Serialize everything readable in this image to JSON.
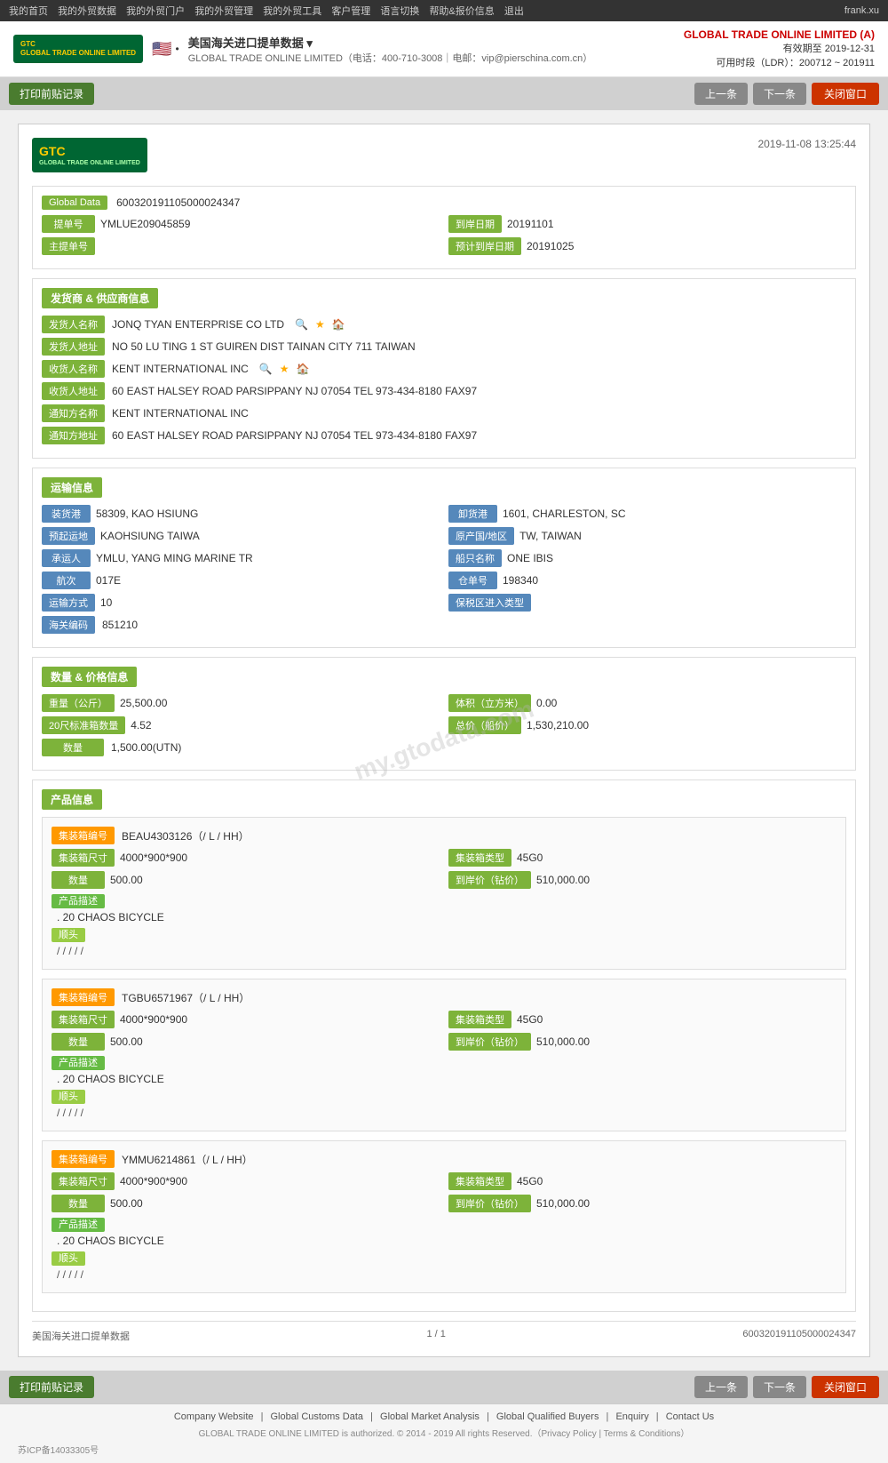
{
  "nav": {
    "items": [
      "我的首页",
      "我的外贸数据",
      "我的外贸门户",
      "我的外贸管理",
      "我的外贸工具",
      "客户管理",
      "语言切换",
      "帮助&报价信息",
      "退出"
    ],
    "user": "frank.xu"
  },
  "header": {
    "logo_line1": "GTC",
    "logo_line2": "GLOBAL TRADE ONLINE LIMITED",
    "flag": "🇺🇸",
    "separator": "•",
    "title": "美国海关进口提单数据 ▾",
    "subtitle": "GLOBAL TRADE ONLINE LIMITED（电话：400-710-3008｜电邮：vip@pierschina.com.cn）",
    "company": "GLOBAL TRADE ONLINE LIMITED (A)",
    "validity_label": "有效期至",
    "validity_date": "2019-12-31",
    "ldr_label": "可用时段（LDR）：",
    "ldr_value": "200712 ~ 201911"
  },
  "toolbar": {
    "print_btn": "打印前贴记录",
    "prev_btn": "上一条",
    "next_btn": "下一条",
    "close_btn": "关闭窗口"
  },
  "doc": {
    "timestamp": "2019-11-08 13:25:44",
    "global_data_label": "Global Data",
    "global_data_value": "600320191105000024347",
    "bill_no_label": "提单号",
    "bill_no_value": "YMLUE209045859",
    "shipdate_label": "到岸日期",
    "shipdate_value": "20191101",
    "master_bill_label": "主提单号",
    "master_bill_value": "",
    "est_date_label": "预计到岸日期",
    "est_date_value": "20191025"
  },
  "supplier": {
    "section_label": "发货商 & 供应商信息",
    "shipper_name_label": "发货人名称",
    "shipper_name_value": "JONQ TYAN ENTERPRISE CO LTD",
    "shipper_addr_label": "发货人地址",
    "shipper_addr_value": "NO 50 LU TING 1 ST GUIREN DIST TAINAN CITY 711 TAIWAN",
    "consignee_name_label": "收货人名称",
    "consignee_name_value": "KENT INTERNATIONAL INC",
    "consignee_addr_label": "收货人地址",
    "consignee_addr_value": "60 EAST HALSEY ROAD PARSIPPANY NJ 07054 TEL 973-434-8180 FAX97",
    "notify_name_label": "通知方名称",
    "notify_name_value": "KENT INTERNATIONAL INC",
    "notify_addr_label": "通知方地址",
    "notify_addr_value": "60 EAST HALSEY ROAD PARSIPPANY NJ 07054 TEL 973-434-8180 FAX97"
  },
  "transport": {
    "section_label": "运输信息",
    "load_port_label": "装货港",
    "load_port_value": "58309, KAO HSIUNG",
    "unload_port_label": "卸货港",
    "unload_port_value": "1601, CHARLESTON, SC",
    "dest_label": "预起运地",
    "dest_value": "KAOHSIUNG TAIWA",
    "country_label": "原产国/地区",
    "country_value": "TW, TAIWAN",
    "carrier_label": "承运人",
    "carrier_value": "YMLU, YANG MING MARINE TR",
    "vessel_label": "船只名称",
    "vessel_value": "ONE IBIS",
    "voyage_label": "航次",
    "voyage_value": "017E",
    "bill_num_label": "仓单号",
    "bill_num_value": "198340",
    "transport_mode_label": "运输方式",
    "transport_mode_value": "10",
    "bonded_label": "保税区进入类型",
    "bonded_value": "",
    "customs_label": "海关编码",
    "customs_value": "851210"
  },
  "quantity": {
    "section_label": "数量 & 价格信息",
    "weight_label": "重量（公斤）",
    "weight_value": "25,500.00",
    "volume_label": "体积（立方米）",
    "volume_value": "0.00",
    "container20_label": "20尺标准箱数量",
    "container20_value": "4.52",
    "price_label": "总价（船价）",
    "price_value": "1,530,210.00",
    "quantity_label": "数量",
    "quantity_value": "1,500.00(UTN)"
  },
  "products": {
    "section_label": "产品信息",
    "items": [
      {
        "container_no_label": "集装箱编号",
        "container_no_value": "BEAU4303126（/ L / HH）",
        "size_label": "集装箱尺寸",
        "size_value": "4000*900*900",
        "type_label": "集装箱类型",
        "type_value": "45G0",
        "qty_label": "数量",
        "qty_value": "500.00",
        "price_label": "到岸价（钻价）",
        "price_value": "510,000.00",
        "desc_label": "产品描述",
        "desc_value": ". 20 CHAOS BICYCLE",
        "seal_label": "顺头",
        "seal_value": "/ / / / /"
      },
      {
        "container_no_label": "集装箱编号",
        "container_no_value": "TGBU6571967（/ L / HH）",
        "size_label": "集装箱尺寸",
        "size_value": "4000*900*900",
        "type_label": "集装箱类型",
        "type_value": "45G0",
        "qty_label": "数量",
        "qty_value": "500.00",
        "price_label": "到岸价（钻价）",
        "price_value": "510,000.00",
        "desc_label": "产品描述",
        "desc_value": ". 20 CHAOS BICYCLE",
        "seal_label": "顺头",
        "seal_value": "/ / / / /"
      },
      {
        "container_no_label": "集装箱编号",
        "container_no_value": "YMMU6214861（/ L / HH）",
        "size_label": "集装箱尺寸",
        "size_value": "4000*900*900",
        "type_label": "集装箱类型",
        "type_value": "45G0",
        "qty_label": "数量",
        "qty_value": "500.00",
        "price_label": "到岸价（钻价）",
        "price_value": "510,000.00",
        "desc_label": "产品描述",
        "desc_value": ". 20 CHAOS BICYCLE",
        "seal_label": "顺头",
        "seal_value": "/ / / / /"
      }
    ]
  },
  "doc_footer": {
    "source": "美国海关进口提单数据",
    "page": "1 / 1",
    "doc_id": "600320191105000024347"
  },
  "bottom_toolbar": {
    "print_btn": "打印前贴记录",
    "prev_btn": "上一条",
    "next_btn": "下一条",
    "close_btn": "关闭窗口"
  },
  "footer": {
    "links": [
      "Company Website",
      "Global Customs Data",
      "Global Market Analysis",
      "Global Qualified Buyers",
      "Enquiry",
      "Contact Us"
    ],
    "copyright": "GLOBAL TRADE ONLINE LIMITED is authorized. © 2014 - 2019 All rights Reserved.（Privacy Policy | Terms & Conditions）",
    "icp": "苏ICP备14033305号"
  },
  "colors": {
    "green_label": "#7db33a",
    "orange_badge": "#ff9900",
    "dark_green_section": "#6aaa1e",
    "transport_blue": "#5588bb",
    "red_close": "#cc3300"
  }
}
